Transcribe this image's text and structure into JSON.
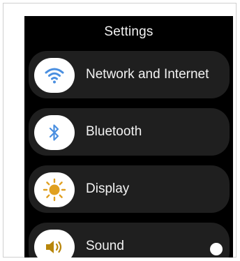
{
  "screen": {
    "title": "Settings",
    "items": [
      {
        "label": "Network and Internet",
        "icon": "wifi-icon",
        "icon_color": "#4a8fe0"
      },
      {
        "label": "Bluetooth",
        "icon": "bluetooth-icon",
        "icon_color": "#4a8fe0"
      },
      {
        "label": "Display",
        "icon": "sun-icon",
        "icon_color": "#e0a020"
      },
      {
        "label": "Sound",
        "icon": "speaker-icon",
        "icon_color": "#b8860b"
      }
    ]
  },
  "colors": {
    "background": "#000000",
    "card": "#1f1f1f",
    "text": "#f2f2f2"
  }
}
